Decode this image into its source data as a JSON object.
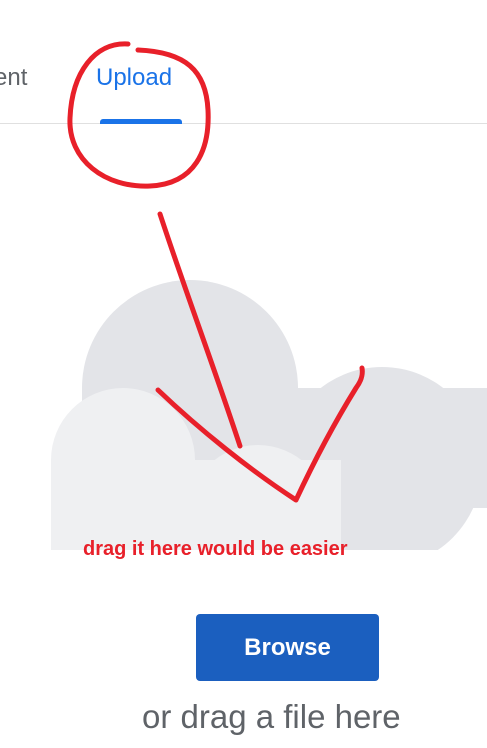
{
  "tabs": {
    "previous_label": "ent",
    "active_label": "Upload"
  },
  "drop_zone": {
    "annotation_text": "drag it here would be easier",
    "browse_label": "Browse",
    "drag_hint": "or drag a file here"
  },
  "colors": {
    "accent": "#1a73e8",
    "button": "#1b5fbf",
    "annotation": "#e8202a",
    "cloud_back": "#e3e4e8",
    "cloud_front": "#eff0f2"
  },
  "icons": {
    "upload_illustration": "cloud-icon"
  }
}
